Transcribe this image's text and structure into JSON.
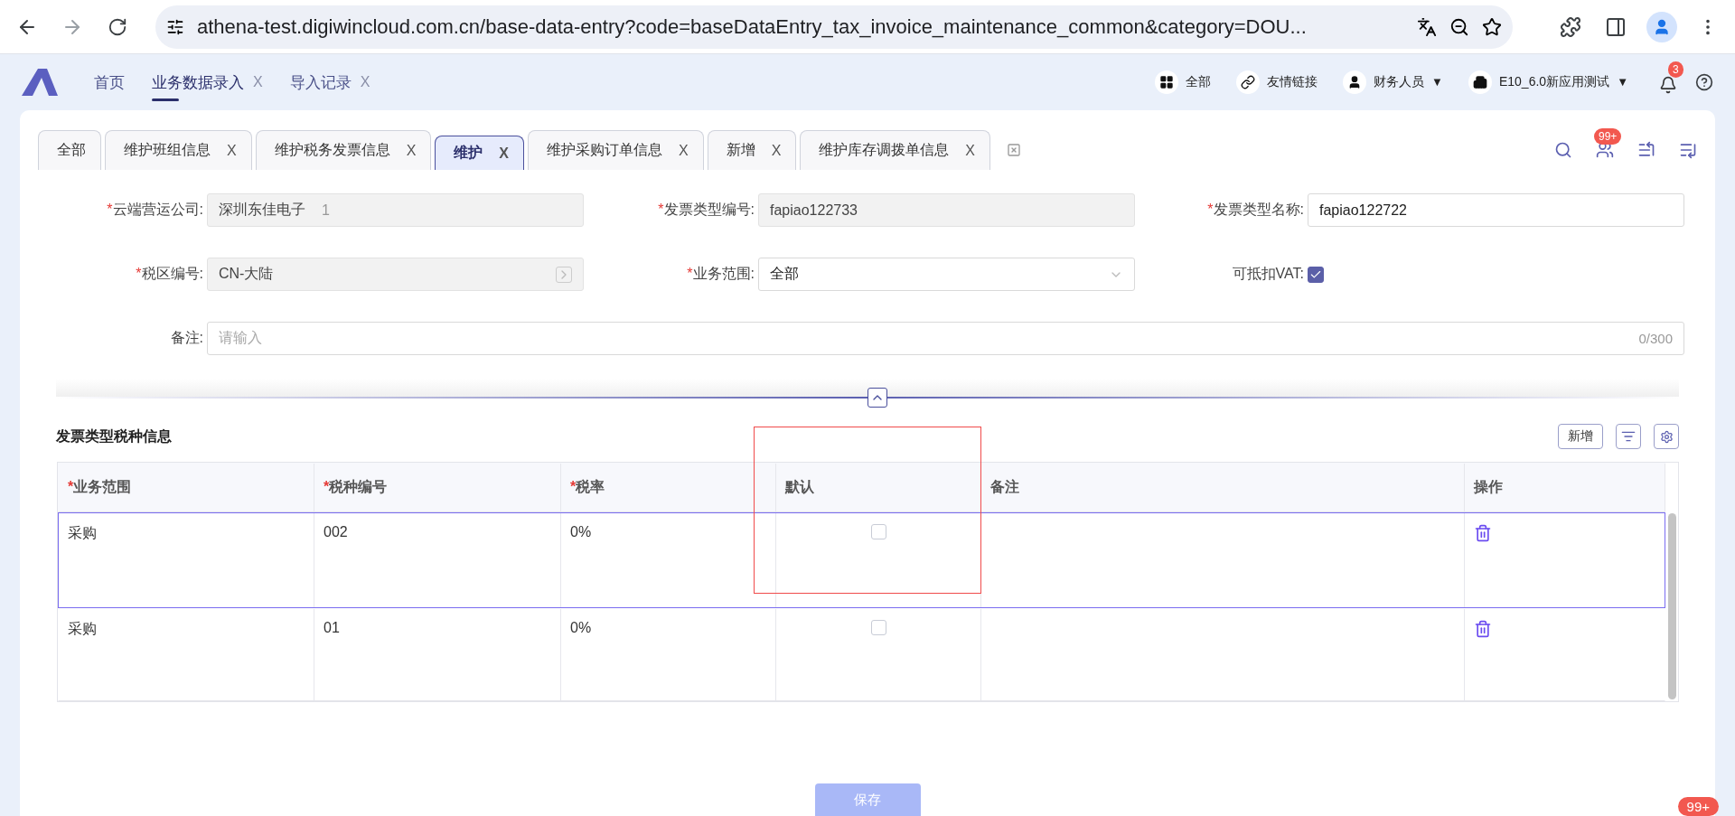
{
  "browser": {
    "url": "athena-test.digiwincloud.com.cn/base-data-entry?code=baseDataEntry_tax_invoice_maintenance_common&category=DOU..."
  },
  "app_header": {
    "nav_tabs": [
      {
        "label": "首页",
        "selected": false
      },
      {
        "label": "业务数据录入",
        "selected": true,
        "close_mark": "X"
      },
      {
        "label": "导入记录",
        "selected": false,
        "close_mark": "X"
      }
    ],
    "actions": [
      {
        "kind": "grid",
        "label": "全部"
      },
      {
        "kind": "link",
        "label": "友情链接"
      },
      {
        "kind": "user",
        "label": "财务人员",
        "dropdown_mark": "▼"
      },
      {
        "kind": "building",
        "label": "E10_6.0新应用测试",
        "dropdown_mark": "▼"
      }
    ],
    "notification_count": "3"
  },
  "page_tabs": [
    {
      "label": "全部",
      "selected": false
    },
    {
      "label": "维护班组信息",
      "selected": false,
      "close_mark": "X"
    },
    {
      "label": "维护税务发票信息",
      "selected": false,
      "close_mark": "X"
    },
    {
      "label": "维护",
      "selected": true,
      "close_mark": "X"
    },
    {
      "label": "维护采购订单信息",
      "selected": false,
      "close_mark": "X"
    },
    {
      "label": "新增",
      "selected": false,
      "close_mark": "X"
    },
    {
      "label": "维护库存调拨单信息",
      "selected": false,
      "close_mark": "X"
    }
  ],
  "toolbar_badge": "99+",
  "form": {
    "fields": [
      {
        "kind": "text",
        "label": "云端营运公司:",
        "required": true,
        "value": "深圳东佳电子",
        "suffix": "1",
        "disabled": true
      },
      {
        "kind": "text",
        "label": "发票类型编号:",
        "required": true,
        "value": "fapiao122733",
        "disabled": true
      },
      {
        "kind": "text",
        "label": "发票类型名称:",
        "required": true,
        "value": "fapiao122722",
        "disabled": false
      },
      {
        "kind": "lookup",
        "label": "税区编号:",
        "required": true,
        "value": "CN-大陆",
        "disabled": true
      },
      {
        "kind": "select",
        "label": "业务范围:",
        "required": true,
        "value": "全部",
        "disabled": false
      },
      {
        "kind": "checkbox",
        "label": "可抵扣VAT:",
        "required": false,
        "checked": true
      },
      {
        "kind": "textarea",
        "label": "备注:",
        "required": false,
        "placeholder": "请输入",
        "counter": "0/300",
        "disabled": false
      }
    ],
    "required_mark": "*"
  },
  "section": {
    "title": "发票类型税种信息",
    "add_button": "新增"
  },
  "table": {
    "columns": [
      {
        "label": "业务范围",
        "required": true
      },
      {
        "label": "税种编号",
        "required": true
      },
      {
        "label": "税率",
        "required": true
      },
      {
        "label": "默认",
        "required": false
      },
      {
        "label": "备注",
        "required": false
      },
      {
        "label": "操作",
        "required": false
      }
    ],
    "rows": [
      {
        "scope": "采购",
        "code": "002",
        "rate": "0%",
        "default": false,
        "selected": true
      },
      {
        "scope": "采购",
        "code": "01",
        "rate": "0%",
        "default": false,
        "selected": false
      }
    ]
  },
  "save_button": {
    "label": "保存",
    "disabled": true
  },
  "floating_badge": "99+"
}
